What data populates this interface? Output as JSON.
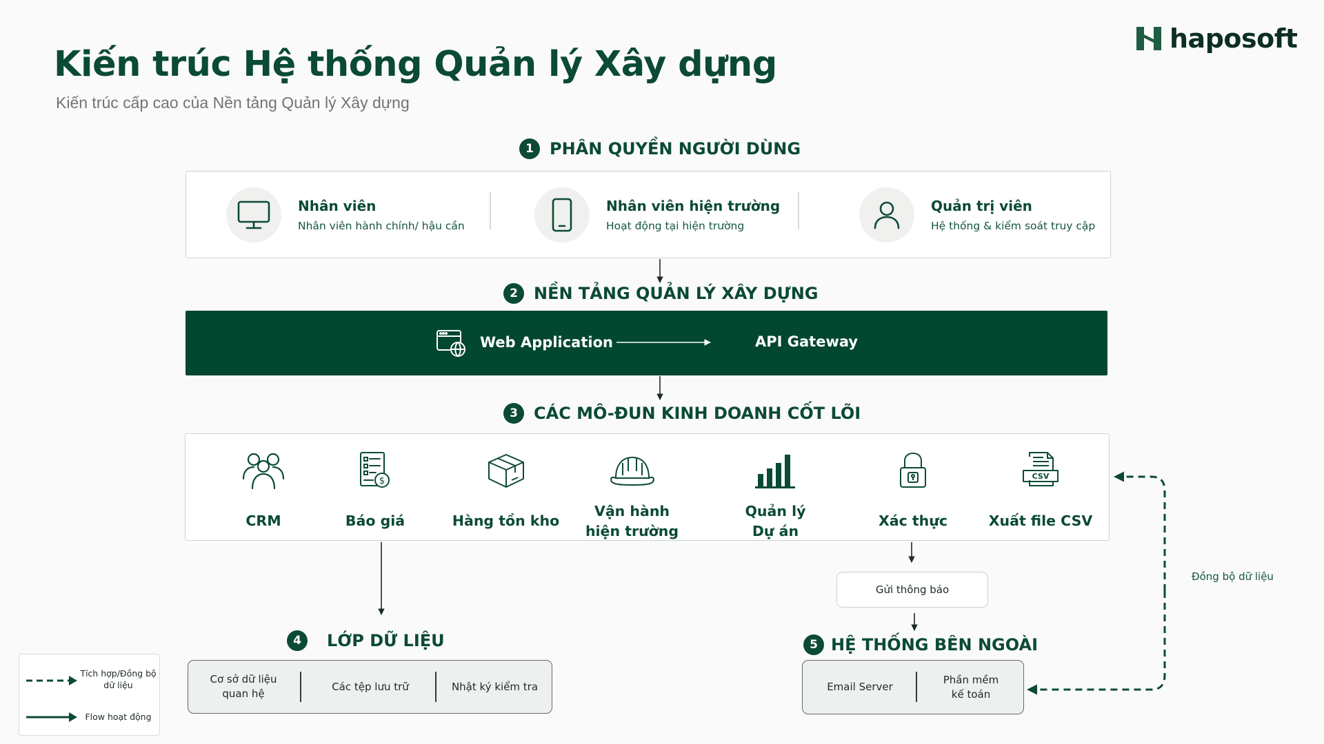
{
  "header": {
    "title": "Kiến trúc Hệ thống Quản lý Xây dựng",
    "subtitle": "Kiến trúc cấp cao của Nền tảng Quản lý Xây dựng",
    "logo_text": "haposoft"
  },
  "sections": {
    "roles": {
      "number": "1",
      "title": "PHÂN QUYỀN NGƯỜI DÙNG",
      "items": [
        {
          "title": "Nhân viên",
          "desc": "Nhân viên hành chính/ hậu cần",
          "icon": "monitor-icon"
        },
        {
          "title": "Nhân viên hiện trường",
          "desc": "Hoạt động tại hiện trường",
          "icon": "smartphone-icon"
        },
        {
          "title": "Quản trị viên",
          "desc": "Hệ thống & kiểm soát truy cập",
          "icon": "user-icon"
        }
      ]
    },
    "platform": {
      "number": "2",
      "title": "NỀN TẢNG QUẢN LÝ XÂY DỰNG",
      "web_app": "Web Application",
      "api_gateway": "API Gateway"
    },
    "modules": {
      "number": "3",
      "title": "CÁC MÔ-ĐUN KINH DOANH CỐT LÕI",
      "items": [
        {
          "line1": "CRM",
          "line2": "",
          "icon": "users-icon"
        },
        {
          "line1": "Báo giá",
          "line2": "",
          "icon": "invoice-icon"
        },
        {
          "line1": "Hàng tồn kho",
          "line2": "",
          "icon": "box-icon"
        },
        {
          "line1": "Vận hành",
          "line2": "hiện trường",
          "icon": "hard-hat-icon"
        },
        {
          "line1": "Quản lý",
          "line2": "Dự án",
          "icon": "bar-chart-icon"
        },
        {
          "line1": "Xác thực",
          "line2": "",
          "icon": "lock-icon"
        },
        {
          "line1": "Xuất file CSV",
          "line2": "",
          "icon": "csv-file-icon"
        }
      ]
    },
    "data_layer": {
      "number": "4",
      "title": "LỚP DỮ LIỆU",
      "items": [
        {
          "line1": "Cơ sở dữ liệu",
          "line2": "quan hệ"
        },
        {
          "line1": "Các tệp lưu trữ",
          "line2": ""
        },
        {
          "line1": "Nhật ký kiểm tra",
          "line2": ""
        }
      ]
    },
    "external": {
      "number": "5",
      "title": "HỆ THỐNG BÊN NGOÀI",
      "items": [
        {
          "line1": "Email Server",
          "line2": ""
        },
        {
          "line1": "Phần mềm",
          "line2": "kế toán"
        }
      ]
    }
  },
  "notify_label": "Gửi thông báo",
  "sync_label": "Đồng bộ dữ liệu",
  "legend": {
    "dashed_line1": "Tích hợp/Đồng bộ",
    "dashed_line2": "dữ liệu",
    "solid": "Flow hoạt động"
  },
  "colors": {
    "primary": "#0b4a33",
    "platform_bar": "#02472f",
    "background": "#fafafa"
  }
}
